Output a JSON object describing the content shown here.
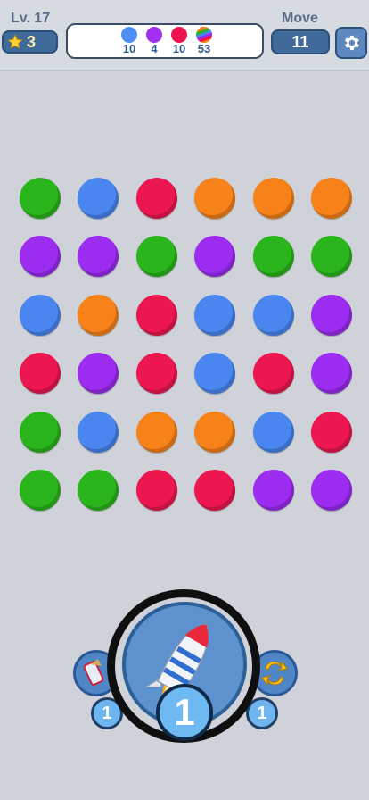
{
  "header": {
    "level_label": "Lv. 17",
    "stars": "3",
    "move_label": "Move",
    "moves": "11",
    "goals": [
      {
        "color": "#4f8ff5",
        "count": "10"
      },
      {
        "color": "#a330ef",
        "count": "4"
      },
      {
        "color": "#ee1450",
        "count": "10"
      },
      {
        "color": "rainbow",
        "count": "53"
      }
    ]
  },
  "board": {
    "rows": 6,
    "cols": 6,
    "grid": [
      [
        "green",
        "blue",
        "red",
        "orange",
        "orange",
        "orange"
      ],
      [
        "purple",
        "purple",
        "green",
        "purple",
        "green",
        "green"
      ],
      [
        "blue",
        "orange",
        "red",
        "blue",
        "blue",
        "purple"
      ],
      [
        "red",
        "purple",
        "red",
        "blue",
        "red",
        "purple"
      ],
      [
        "green",
        "blue",
        "orange",
        "orange",
        "blue",
        "red"
      ],
      [
        "green",
        "green",
        "red",
        "red",
        "purple",
        "purple"
      ]
    ],
    "colors": {
      "green": "#2bb51c",
      "blue": "#4a86ef",
      "red": "#ec1650",
      "orange": "#f7821a",
      "purple": "#9c2cef"
    }
  },
  "boosters": {
    "left_count": "1",
    "center_count": "1",
    "right_count": "1"
  }
}
